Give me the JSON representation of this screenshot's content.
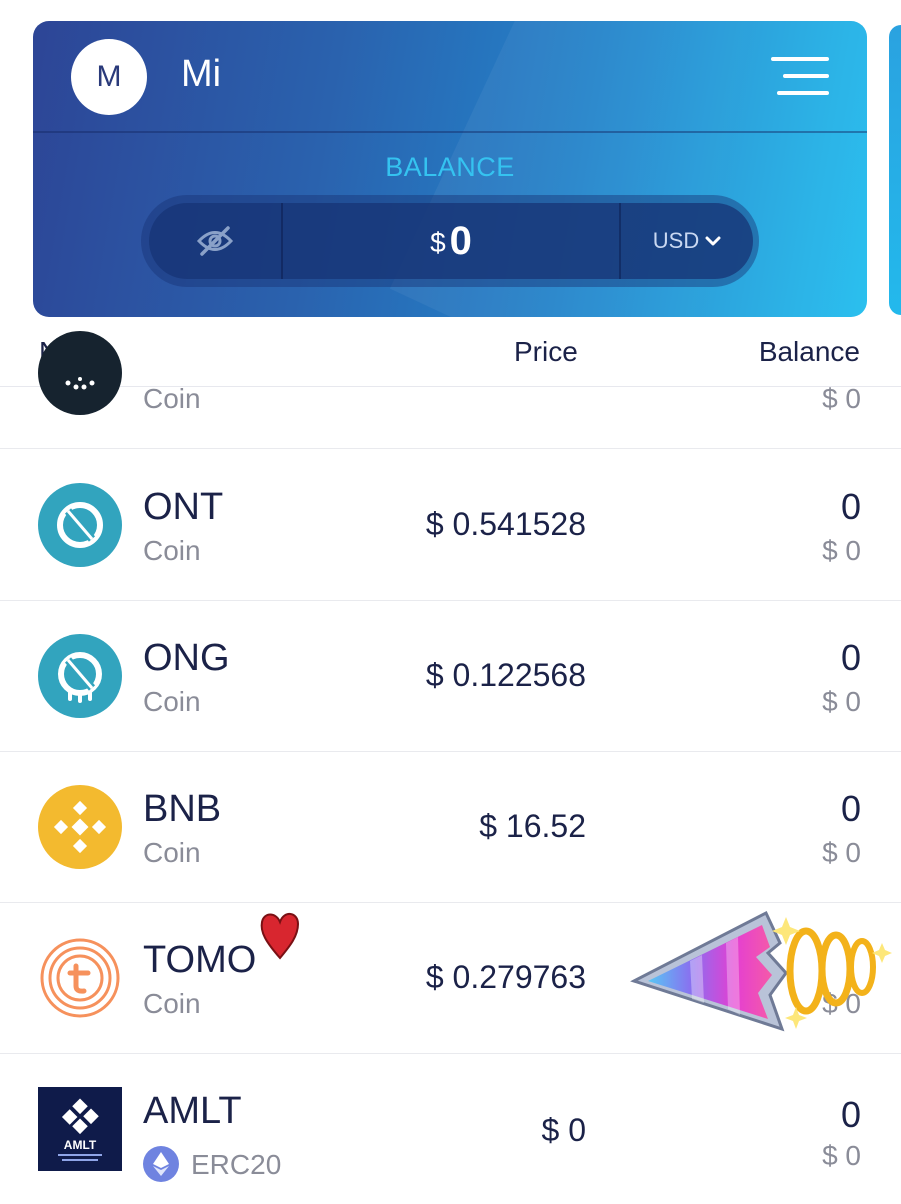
{
  "header": {
    "avatar_letter": "M",
    "user_name": "Mi",
    "balance_label": "BALANCE",
    "currency_symbol": "$",
    "balance_value": "0",
    "currency": "USD"
  },
  "columns": {
    "name": "Name",
    "price": "Price",
    "balance": "Balance"
  },
  "rows": [
    {
      "symbol": "",
      "type": "Coin",
      "price": "",
      "balance": "",
      "balance_usd": "$ 0",
      "icon": "cardano-icon"
    },
    {
      "symbol": "ONT",
      "type": "Coin",
      "price": "$ 0.541528",
      "balance": "0",
      "balance_usd": "$ 0",
      "icon": "ont-icon"
    },
    {
      "symbol": "ONG",
      "type": "Coin",
      "price": "$ 0.122568",
      "balance": "0",
      "balance_usd": "$ 0",
      "icon": "ong-icon"
    },
    {
      "symbol": "BNB",
      "type": "Coin",
      "price": "$ 16.52",
      "balance": "0",
      "balance_usd": "$ 0",
      "icon": "bnb-icon"
    },
    {
      "symbol": "TOMO",
      "type": "Coin",
      "price": "$ 0.279763",
      "balance": "",
      "balance_usd": "$ 0",
      "icon": "tomo-icon"
    },
    {
      "symbol": "AMLT",
      "type": "ERC20",
      "price": "$ 0",
      "balance": "0",
      "balance_usd": "$ 0",
      "icon": "amlt-icon"
    }
  ],
  "stickers": [
    "heart-sticker",
    "arrow-sticker"
  ],
  "colors": {
    "accent": "#35c3f0",
    "ont": "#32a4be",
    "bnb": "#f3ba2f",
    "tomo": "#f6915c",
    "text": "#1b2248",
    "muted": "#8a8c98"
  }
}
